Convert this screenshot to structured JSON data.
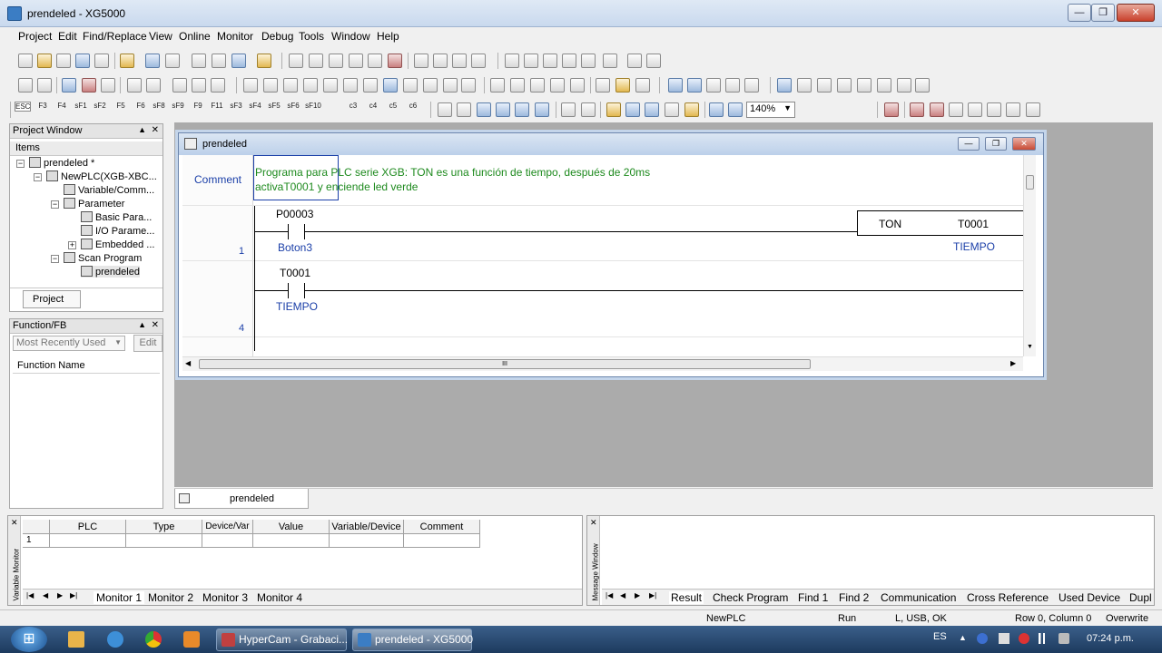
{
  "window": {
    "title": "prendeled - XG5000",
    "min": "—",
    "max": "❐",
    "close": "✕"
  },
  "menu": [
    "Project",
    "Edit",
    "Find/Replace",
    "View",
    "Online",
    "Monitor",
    "Debug",
    "Tools",
    "Window",
    "Help"
  ],
  "toolbar3": {
    "fkeys": [
      "ESC",
      "F3",
      "F4",
      "sF1",
      "sF2",
      "F5",
      "F6",
      "sF8",
      "sF9",
      "F9",
      "F11",
      "sF3",
      "sF4",
      "sF5",
      "sF6",
      "sF10",
      "c3",
      "c4",
      "c5",
      "c6"
    ],
    "zoom": "140%"
  },
  "project_window": {
    "title": "Project Window",
    "col_header": "Items",
    "tree": [
      "prendeled *",
      "NewPLC(XGB-XBC...",
      "Variable/Comm...",
      "Parameter",
      "Basic Para...",
      "I/O Parame...",
      "Embedded ...",
      "Scan Program",
      "prendeled"
    ],
    "tab": "Project"
  },
  "function_fb": {
    "title": "Function/FB",
    "dropdown": "Most Recently Used",
    "edit_btn": "Edit",
    "col_header": "Function Name"
  },
  "ladder": {
    "title": "prendeled",
    "comment_label": "Comment",
    "comment_text_1": "Programa para PLC serie XGB: TON es una función de tiempo, después de 20ms",
    "comment_text_2": "activaT0001 y enciende led verde",
    "rungs": [
      {
        "num": "1",
        "contact": "P00003",
        "comment": "Boton3",
        "fb_name": "TON",
        "fb_arg": "T0001",
        "fb_comment": "TIEMPO"
      },
      {
        "num": "4",
        "contact": "T0001",
        "comment": "TIEMPO"
      }
    ],
    "scroll_h_grip": "III"
  },
  "doc_tab": "prendeled",
  "variable_monitor": {
    "side_label": "Variable Monitor",
    "columns": [
      "PLC",
      "Type",
      "Device/Var",
      "Value",
      "Variable/Device",
      "Comment"
    ],
    "row_num": "1",
    "tabs": [
      "Monitor 1",
      "Monitor 2",
      "Monitor 3",
      "Monitor 4"
    ]
  },
  "message_window": {
    "side_label": "Message Window",
    "tabs": [
      "Result",
      "Check Program",
      "Find 1",
      "Find 2",
      "Communication",
      "Cross Reference",
      "Used Device",
      "Dupl"
    ]
  },
  "status": {
    "plc": "NewPLC",
    "mode": "Run",
    "conn": "L, USB, OK",
    "pos": "Row 0, Column 0",
    "ins": "Overwrite"
  },
  "taskbar": {
    "start": "⊞",
    "items": [
      "HyperCam - Grabaci...",
      "prendeled - XG5000"
    ],
    "lang": "ES",
    "time": "07:24 p.m."
  },
  "colors": {
    "rung_number": "#1b3fa8",
    "comment_green": "#1e8a1e",
    "titlebar": "#c9d9ee"
  }
}
